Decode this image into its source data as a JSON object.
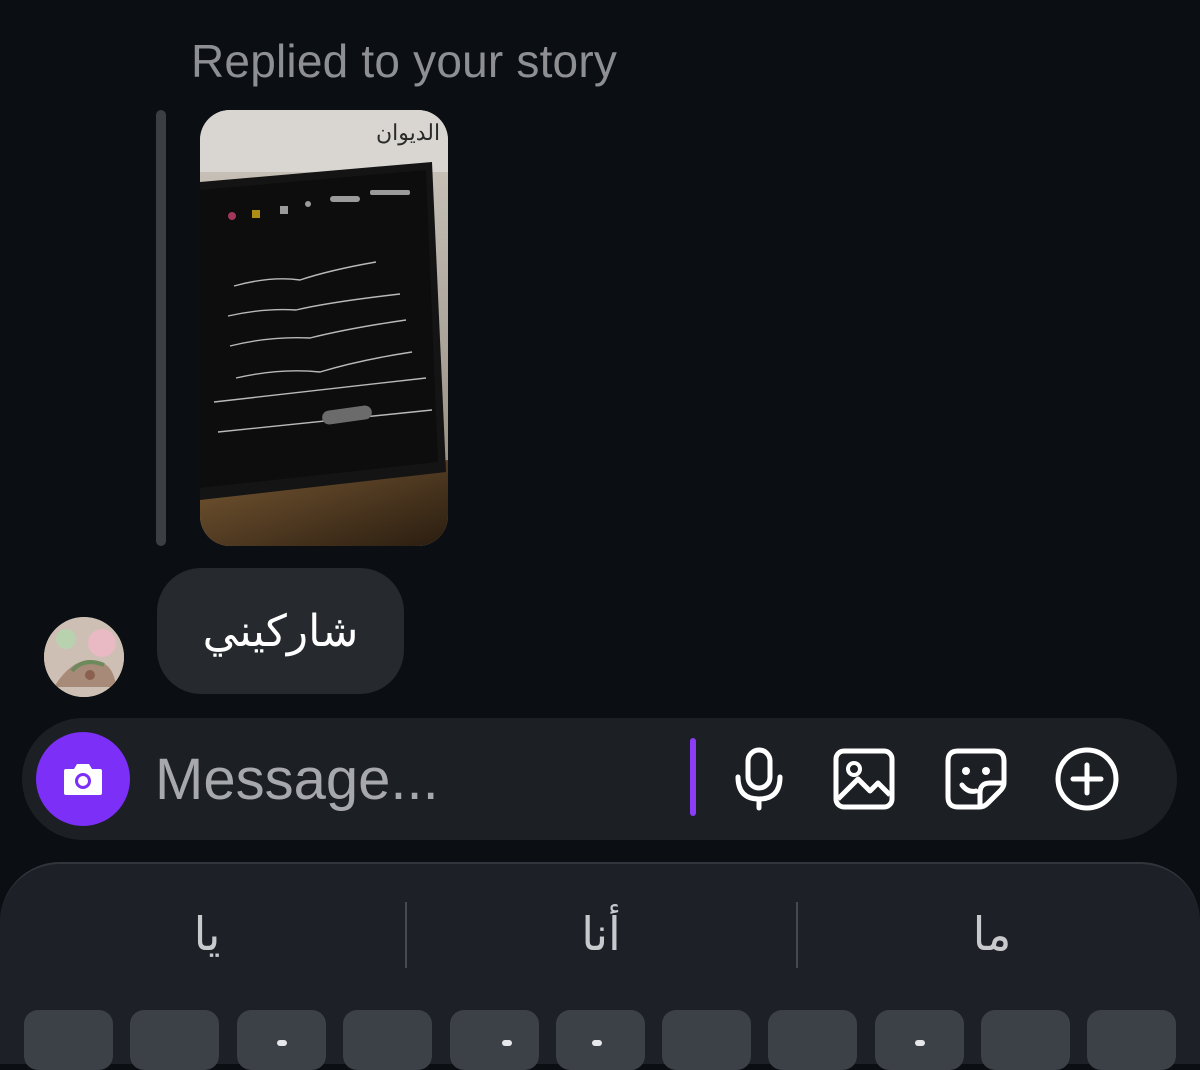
{
  "story_reply": {
    "header": "Replied to your story",
    "thumbnail_icon": "story-thumbnail-image"
  },
  "message": {
    "text": "شاركيني",
    "avatar_icon": "contact-avatar"
  },
  "composer": {
    "placeholder": "Message...",
    "value": "",
    "camera_icon": "camera-icon",
    "mic_icon": "microphone-icon",
    "gallery_icon": "image-icon",
    "sticker_icon": "sticker-icon",
    "more_icon": "plus-circle-icon",
    "accent": "#7b2ff7"
  },
  "keyboard": {
    "suggestions": [
      "يا",
      "أنا",
      "ما"
    ],
    "key_color": "#3c4047"
  },
  "colors": {
    "background": "#0b0e12",
    "bubble": "#262a2f",
    "composer": "#1c1f24"
  }
}
